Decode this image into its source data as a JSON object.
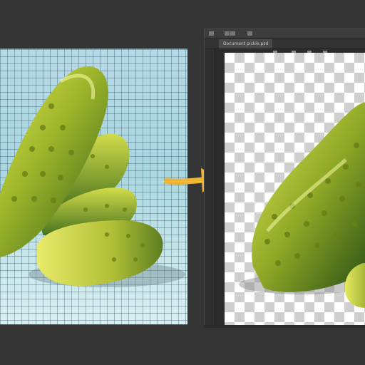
{
  "editor": {
    "document_tab": "Document pickle.psd",
    "titlebar_icons": [
      "menu-icon",
      "minimize-icon",
      "maximize-icon",
      "close-icon"
    ]
  },
  "colors": {
    "background": "#353535",
    "pickle_light": "#c8d43a",
    "pickle_dark": "#2f5a1a",
    "arrow": "#f2b531"
  }
}
